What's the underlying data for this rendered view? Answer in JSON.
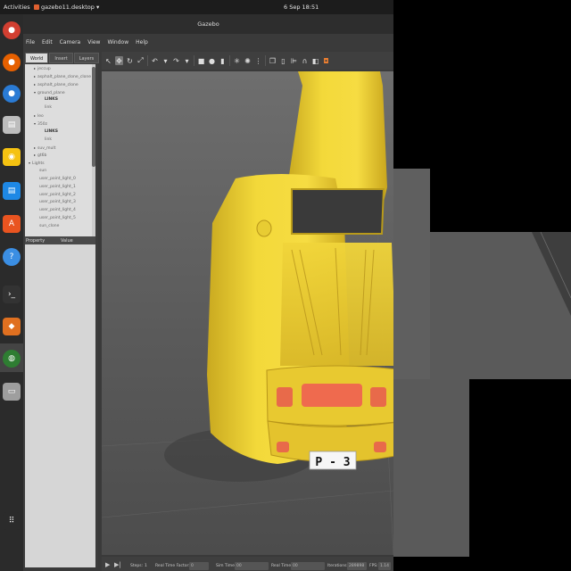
{
  "topbar": {
    "activities": "Activities",
    "app_name": "gazebo11.desktop ▾",
    "clock": "6 Sep 18:51"
  },
  "dock": {
    "items": [
      {
        "name": "chrome-icon",
        "color": "#d23f31",
        "glyph": "●"
      },
      {
        "name": "firefox-icon",
        "color": "#e66000",
        "glyph": "●"
      },
      {
        "name": "thunderbird-icon",
        "color": "#2a7bd5",
        "glyph": "●"
      },
      {
        "name": "files-icon",
        "color": "#bdbdbd",
        "glyph": "▤"
      },
      {
        "name": "rhythmbox-icon",
        "color": "#f5c211",
        "glyph": "◉"
      },
      {
        "name": "writer-icon",
        "color": "#1e88e5",
        "glyph": "▤"
      },
      {
        "name": "software-icon",
        "color": "#e95420",
        "glyph": "A"
      },
      {
        "name": "help-icon",
        "color": "#3b8ee3",
        "glyph": "?"
      },
      {
        "name": "terminal-icon",
        "color": "#333333",
        "glyph": "›_"
      },
      {
        "name": "gazebo-icon",
        "color": "#e07020",
        "glyph": "◆"
      },
      {
        "name": "globe-icon",
        "color": "#2e7d32",
        "glyph": "◍"
      },
      {
        "name": "disk-icon",
        "color": "#9e9e9e",
        "glyph": "▭"
      },
      {
        "name": "show-apps-icon",
        "color": "#2b2b2b",
        "glyph": "⠿"
      }
    ]
  },
  "window": {
    "title": "Gazebo",
    "menu": [
      "File",
      "Edit",
      "Camera",
      "View",
      "Window",
      "Help"
    ]
  },
  "left_panel": {
    "tabs": [
      "World",
      "Insert",
      "Layers"
    ],
    "active_tab": "World",
    "tree": [
      {
        "label": "jeccup",
        "arrow": "▸",
        "indent": 1,
        "bold": false
      },
      {
        "label": "asphalt_plane_clone_clone",
        "arrow": "▸",
        "indent": 1,
        "bold": false
      },
      {
        "label": "asphalt_plane_clone",
        "arrow": "▸",
        "indent": 1,
        "bold": false
      },
      {
        "label": "ground_plane",
        "arrow": "▾",
        "indent": 1,
        "bold": false
      },
      {
        "label": "LINKS",
        "arrow": "",
        "indent": 3,
        "bold": true
      },
      {
        "label": "link",
        "arrow": "",
        "indent": 3,
        "bold": false
      },
      {
        "label": "leo",
        "arrow": "▸",
        "indent": 1,
        "bold": false
      },
      {
        "label": "350z",
        "arrow": "▾",
        "indent": 1,
        "bold": false
      },
      {
        "label": "LINKS",
        "arrow": "",
        "indent": 3,
        "bold": true
      },
      {
        "label": "link",
        "arrow": "",
        "indent": 3,
        "bold": false
      },
      {
        "label": "suv_mult",
        "arrow": "▸",
        "indent": 1,
        "bold": false
      },
      {
        "label": "gt6b",
        "arrow": "▸",
        "indent": 1,
        "bold": false
      },
      {
        "label": "Lights",
        "arrow": "▾",
        "indent": 0,
        "bold": false
      },
      {
        "label": "sun",
        "arrow": "",
        "indent": 2,
        "bold": false
      },
      {
        "label": "user_point_light_0",
        "arrow": "",
        "indent": 2,
        "bold": false
      },
      {
        "label": "user_point_light_1",
        "arrow": "",
        "indent": 2,
        "bold": false
      },
      {
        "label": "user_point_light_2",
        "arrow": "",
        "indent": 2,
        "bold": false
      },
      {
        "label": "user_point_light_3",
        "arrow": "",
        "indent": 2,
        "bold": false
      },
      {
        "label": "user_point_light_4",
        "arrow": "",
        "indent": 2,
        "bold": false
      },
      {
        "label": "user_point_light_5",
        "arrow": "",
        "indent": 2,
        "bold": false
      },
      {
        "label": "sun_clone",
        "arrow": "",
        "indent": 2,
        "bold": false
      }
    ],
    "props": {
      "col_property": "Property",
      "col_value": "Value"
    }
  },
  "toolbar": {
    "tools": [
      {
        "name": "select-icon",
        "glyph": "↖",
        "active": false
      },
      {
        "name": "translate-icon",
        "glyph": "✥",
        "active": true
      },
      {
        "name": "rotate-icon",
        "glyph": "↻",
        "active": false
      },
      {
        "name": "scale-icon",
        "glyph": "⤢",
        "active": false
      },
      {
        "name": "sep",
        "glyph": "",
        "active": false
      },
      {
        "name": "undo-icon",
        "glyph": "↶",
        "active": false
      },
      {
        "name": "undo-menu-icon",
        "glyph": "▾",
        "active": false
      },
      {
        "name": "redo-icon",
        "glyph": "↷",
        "active": false
      },
      {
        "name": "redo-menu-icon",
        "glyph": "▾",
        "active": false
      },
      {
        "name": "sep",
        "glyph": "",
        "active": false
      },
      {
        "name": "box-icon",
        "glyph": "■",
        "active": false
      },
      {
        "name": "sphere-icon",
        "glyph": "●",
        "active": false
      },
      {
        "name": "cylinder-icon",
        "glyph": "▮",
        "active": false
      },
      {
        "name": "sep",
        "glyph": "",
        "active": false
      },
      {
        "name": "point-light-icon",
        "glyph": "✳",
        "active": false
      },
      {
        "name": "spot-light-icon",
        "glyph": "✺",
        "active": false
      },
      {
        "name": "directional-light-icon",
        "glyph": "⋮",
        "active": false
      },
      {
        "name": "sep",
        "glyph": "",
        "active": false
      },
      {
        "name": "copy-icon",
        "glyph": "❐",
        "active": false
      },
      {
        "name": "paste-icon",
        "glyph": "▯",
        "active": false
      },
      {
        "name": "align-icon",
        "glyph": "⊫",
        "active": false
      },
      {
        "name": "snap-icon",
        "glyph": "∩",
        "active": false
      },
      {
        "name": "change-view-icon",
        "glyph": "◧",
        "active": false
      },
      {
        "name": "screenshot-icon",
        "glyph": "◘",
        "active": false
      }
    ]
  },
  "viewport": {
    "car_color": "#f2d431",
    "plate_text": "P - 3"
  },
  "statusbar": {
    "steps_label": "Steps:",
    "steps_value": "1",
    "rtf_label": "Real Time Factor:",
    "rtf_value": "0",
    "sim_time_label": "Sim Time:",
    "sim_time_value": "00 00:25:45.334",
    "real_time_label": "Real Time:",
    "real_time_value": "00 00:37:43.555",
    "iterations_label": "Iterations:",
    "iterations_value": "289898",
    "fps_label": "FPS:",
    "fps_value": "1.14"
  }
}
